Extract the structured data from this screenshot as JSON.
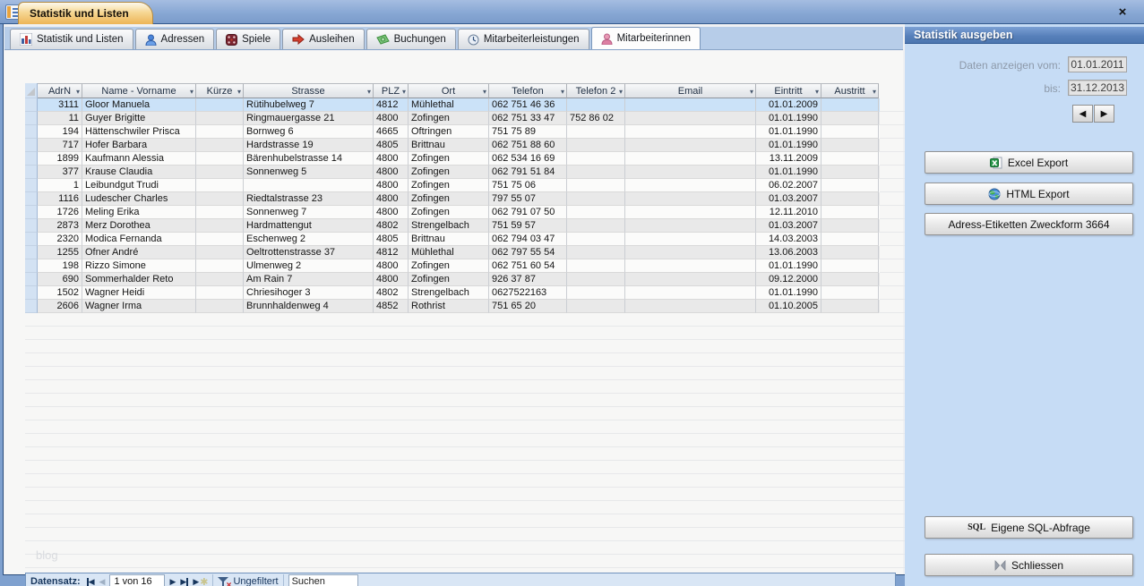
{
  "window": {
    "doc_tab_title": "Statistik und Listen",
    "close_glyph": "×"
  },
  "tabs": [
    {
      "label": "Statistik und Listen",
      "icon": "bar-chart-icon",
      "active": false
    },
    {
      "label": "Adressen",
      "icon": "person-blue-icon",
      "active": false
    },
    {
      "label": "Spiele",
      "icon": "dice-icon",
      "active": false
    },
    {
      "label": "Ausleihen",
      "icon": "red-arrow-icon",
      "active": false
    },
    {
      "label": "Buchungen",
      "icon": "banknote-icon",
      "active": false
    },
    {
      "label": "Mitarbeiterleistungen",
      "icon": "clock-icon",
      "active": false
    },
    {
      "label": "Mitarbeiterinnen",
      "icon": "person-pink-icon",
      "active": true
    }
  ],
  "table": {
    "columns": [
      "AdrN",
      "Name - Vorname",
      "Kürze",
      "Strasse",
      "PLZ",
      "Ort",
      "Telefon",
      "Telefon 2",
      "Email",
      "Eintritt",
      "Austritt"
    ],
    "rows": [
      [
        "3111",
        "Gloor Manuela",
        "",
        "Rütihubelweg 7",
        "4812",
        "Mühlethal",
        "062 751 46 36",
        "",
        "",
        "01.01.2009",
        ""
      ],
      [
        "11",
        "Guyer Brigitte",
        "",
        "Ringmauergasse 21",
        "4800",
        "Zofingen",
        "062 751 33 47",
        "752 86 02",
        "",
        "01.01.1990",
        ""
      ],
      [
        "194",
        "Hättenschwiler Prisca",
        "",
        "Bornweg 6",
        "4665",
        "Oftringen",
        "751 75 89",
        "",
        "",
        "01.01.1990",
        ""
      ],
      [
        "717",
        "Hofer Barbara",
        "",
        "Hardstrasse 19",
        "4805",
        "Brittnau",
        "062  751 88 60",
        "",
        "",
        "01.01.1990",
        ""
      ],
      [
        "1899",
        "Kaufmann Alessia",
        "",
        "Bärenhubelstrasse 14",
        "4800",
        "Zofingen",
        "062  534 16 69",
        "",
        "",
        "13.11.2009",
        ""
      ],
      [
        "377",
        "Krause Claudia",
        "",
        "Sonnenweg 5",
        "4800",
        "Zofingen",
        "062 791 51 84",
        "",
        "",
        "01.01.1990",
        ""
      ],
      [
        "1",
        "Leibundgut Trudi",
        "",
        "",
        "4800",
        "Zofingen",
        "751 75 06",
        "",
        "",
        "06.02.2007",
        ""
      ],
      [
        "1116",
        "Ludescher Charles",
        "",
        "Riedtalstrasse 23",
        "4800",
        "Zofingen",
        "797 55 07",
        "",
        "",
        "01.03.2007",
        ""
      ],
      [
        "1726",
        "Meling Erika",
        "",
        "Sonnenweg 7",
        "4800",
        "Zofingen",
        "062 791 07 50",
        "",
        "",
        "12.11.2010",
        ""
      ],
      [
        "2873",
        "Merz Dorothea",
        "",
        "Hardmattengut",
        "4802",
        "Strengelbach",
        "751 59 57",
        "",
        "",
        "01.03.2007",
        ""
      ],
      [
        "2320",
        "Modica Fernanda",
        "",
        "Eschenweg 2",
        "4805",
        "Brittnau",
        "062 794 03 47",
        "",
        "",
        "14.03.2003",
        ""
      ],
      [
        "1255",
        "Ofner André",
        "",
        "Oeltrottenstrasse 37",
        "4812",
        "Mühlethal",
        "062  797 55 54",
        "",
        "",
        "13.06.2003",
        ""
      ],
      [
        "198",
        "Rizzo Simone",
        "",
        "Ulmenweg 2",
        "4800",
        "Zofingen",
        "062  751 60 54",
        "",
        "",
        "01.01.1990",
        ""
      ],
      [
        "690",
        "Sommerhalder Reto",
        "",
        "Am Rain 7",
        "4800",
        "Zofingen",
        "926 37 87",
        "",
        "",
        "09.12.2000",
        ""
      ],
      [
        "1502",
        "Wagner Heidi",
        "",
        "Chriesihoger 3",
        "4802",
        "Strengelbach",
        "0627522163",
        "",
        "",
        "01.01.1990",
        ""
      ],
      [
        "2606",
        "Wagner Irma",
        "",
        "Brunnhaldenweg 4",
        "4852",
        "Rothrist",
        "751 65 20",
        "",
        "",
        "01.10.2005",
        ""
      ]
    ],
    "selected_row_index": 0
  },
  "record_bar": {
    "label": "Datensatz:",
    "position": "1 von 16",
    "filter_label": "Ungefiltert",
    "search_text": "Suchen"
  },
  "panel": {
    "title": "Statistik ausgeben",
    "date_from_label": "Daten anzeigen vom:",
    "date_from_value": "01.01.2011",
    "date_to_label": "bis:",
    "date_to_value": "31.12.2013",
    "excel_button": "Excel Export",
    "html_button": "HTML Export",
    "labels_button": "Adress-Etiketten Zweckform 3664",
    "sql_button": "Eigene SQL-Abfrage",
    "sql_glyph": "SQL",
    "close_button": "Schliessen"
  },
  "watermark": "blog",
  "colors": {
    "window_blue": "#7fa1cf",
    "panel_blue": "#c6dcf5",
    "panel_header_blue": "#567fb9",
    "doc_tab_orange": "#edb558",
    "selected_row": "#cbe2f8",
    "alt_row": "#e9e9e9",
    "navy_text": "#17365d"
  }
}
